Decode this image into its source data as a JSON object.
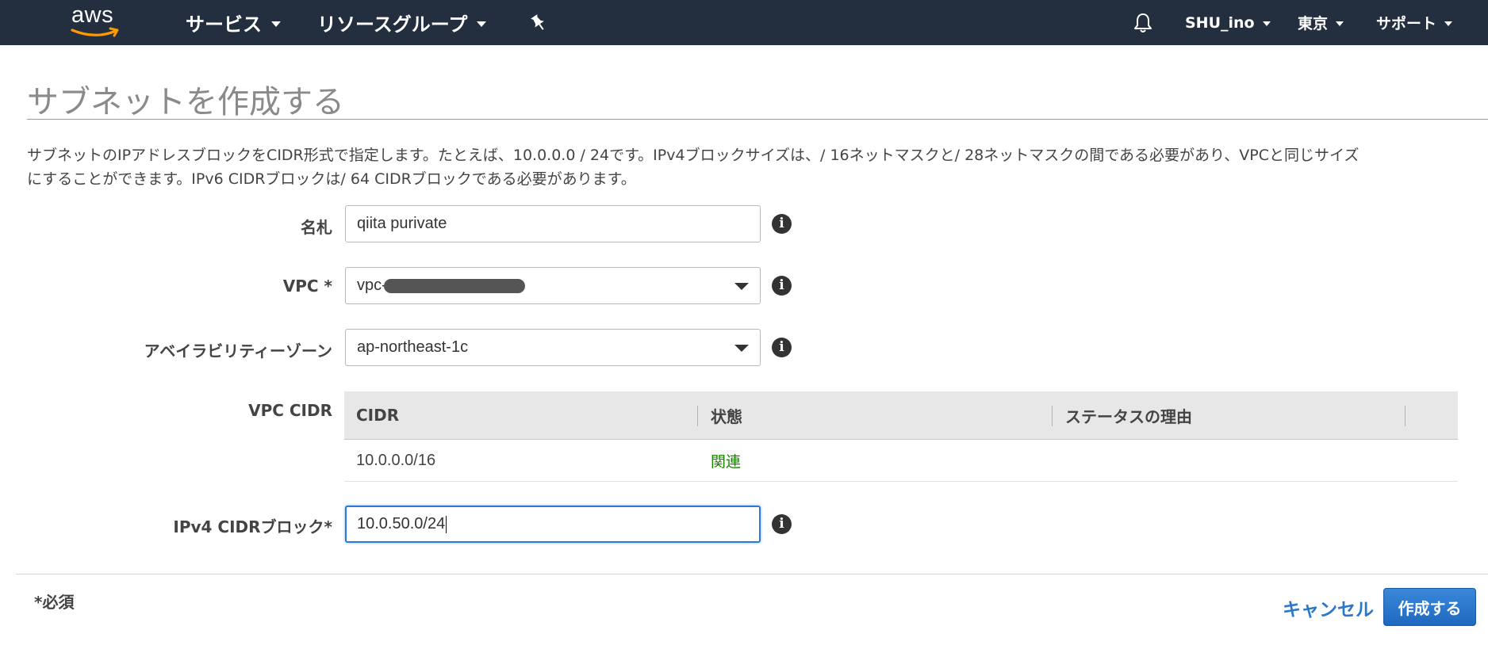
{
  "nav": {
    "logo": "aws",
    "services": "サービス",
    "resource_groups": "リソースグループ",
    "pin_icon": "pushpin-icon",
    "bell_icon": "bell-icon",
    "user": "SHU_ino",
    "region": "東京",
    "support": "サポート"
  },
  "page": {
    "title": "サブネットを作成する",
    "description_line1": "サブネットのIPアドレスブロックをCIDR形式で指定します。たとえば、10.0.0.0 / 24です。IPv4ブロックサイズは、/ 16ネットマスクと/ 28ネットマスクの間である必要があり、VPCと同じサイズ",
    "description_line2": "にすることができます。IPv6 CIDRブロックは/ 64 CIDRブロックである必要があります。"
  },
  "form": {
    "name": {
      "label": "名札",
      "value": "qiita purivate"
    },
    "vpc": {
      "label": "VPC *",
      "value": "vpc-"
    },
    "az": {
      "label": "アベイラビリティーゾーン",
      "value": "ap-northeast-1c"
    },
    "vpc_cidr": {
      "label": "VPC CIDR",
      "columns": [
        "CIDR",
        "状態",
        "ステータスの理由"
      ],
      "rows": [
        {
          "cidr": "10.0.0.0/16",
          "status": "関連",
          "reason": ""
        }
      ]
    },
    "ipv4": {
      "label": "IPv4 CIDRブロック*",
      "value": "10.0.50.0/24"
    }
  },
  "footer": {
    "required": "*必須",
    "cancel": "キャンセル",
    "create": "作成する"
  },
  "colors": {
    "nav_bg": "#232f3e",
    "primary": "#1f68c0",
    "link": "#2c78c8",
    "status_ok": "#1d8102"
  }
}
